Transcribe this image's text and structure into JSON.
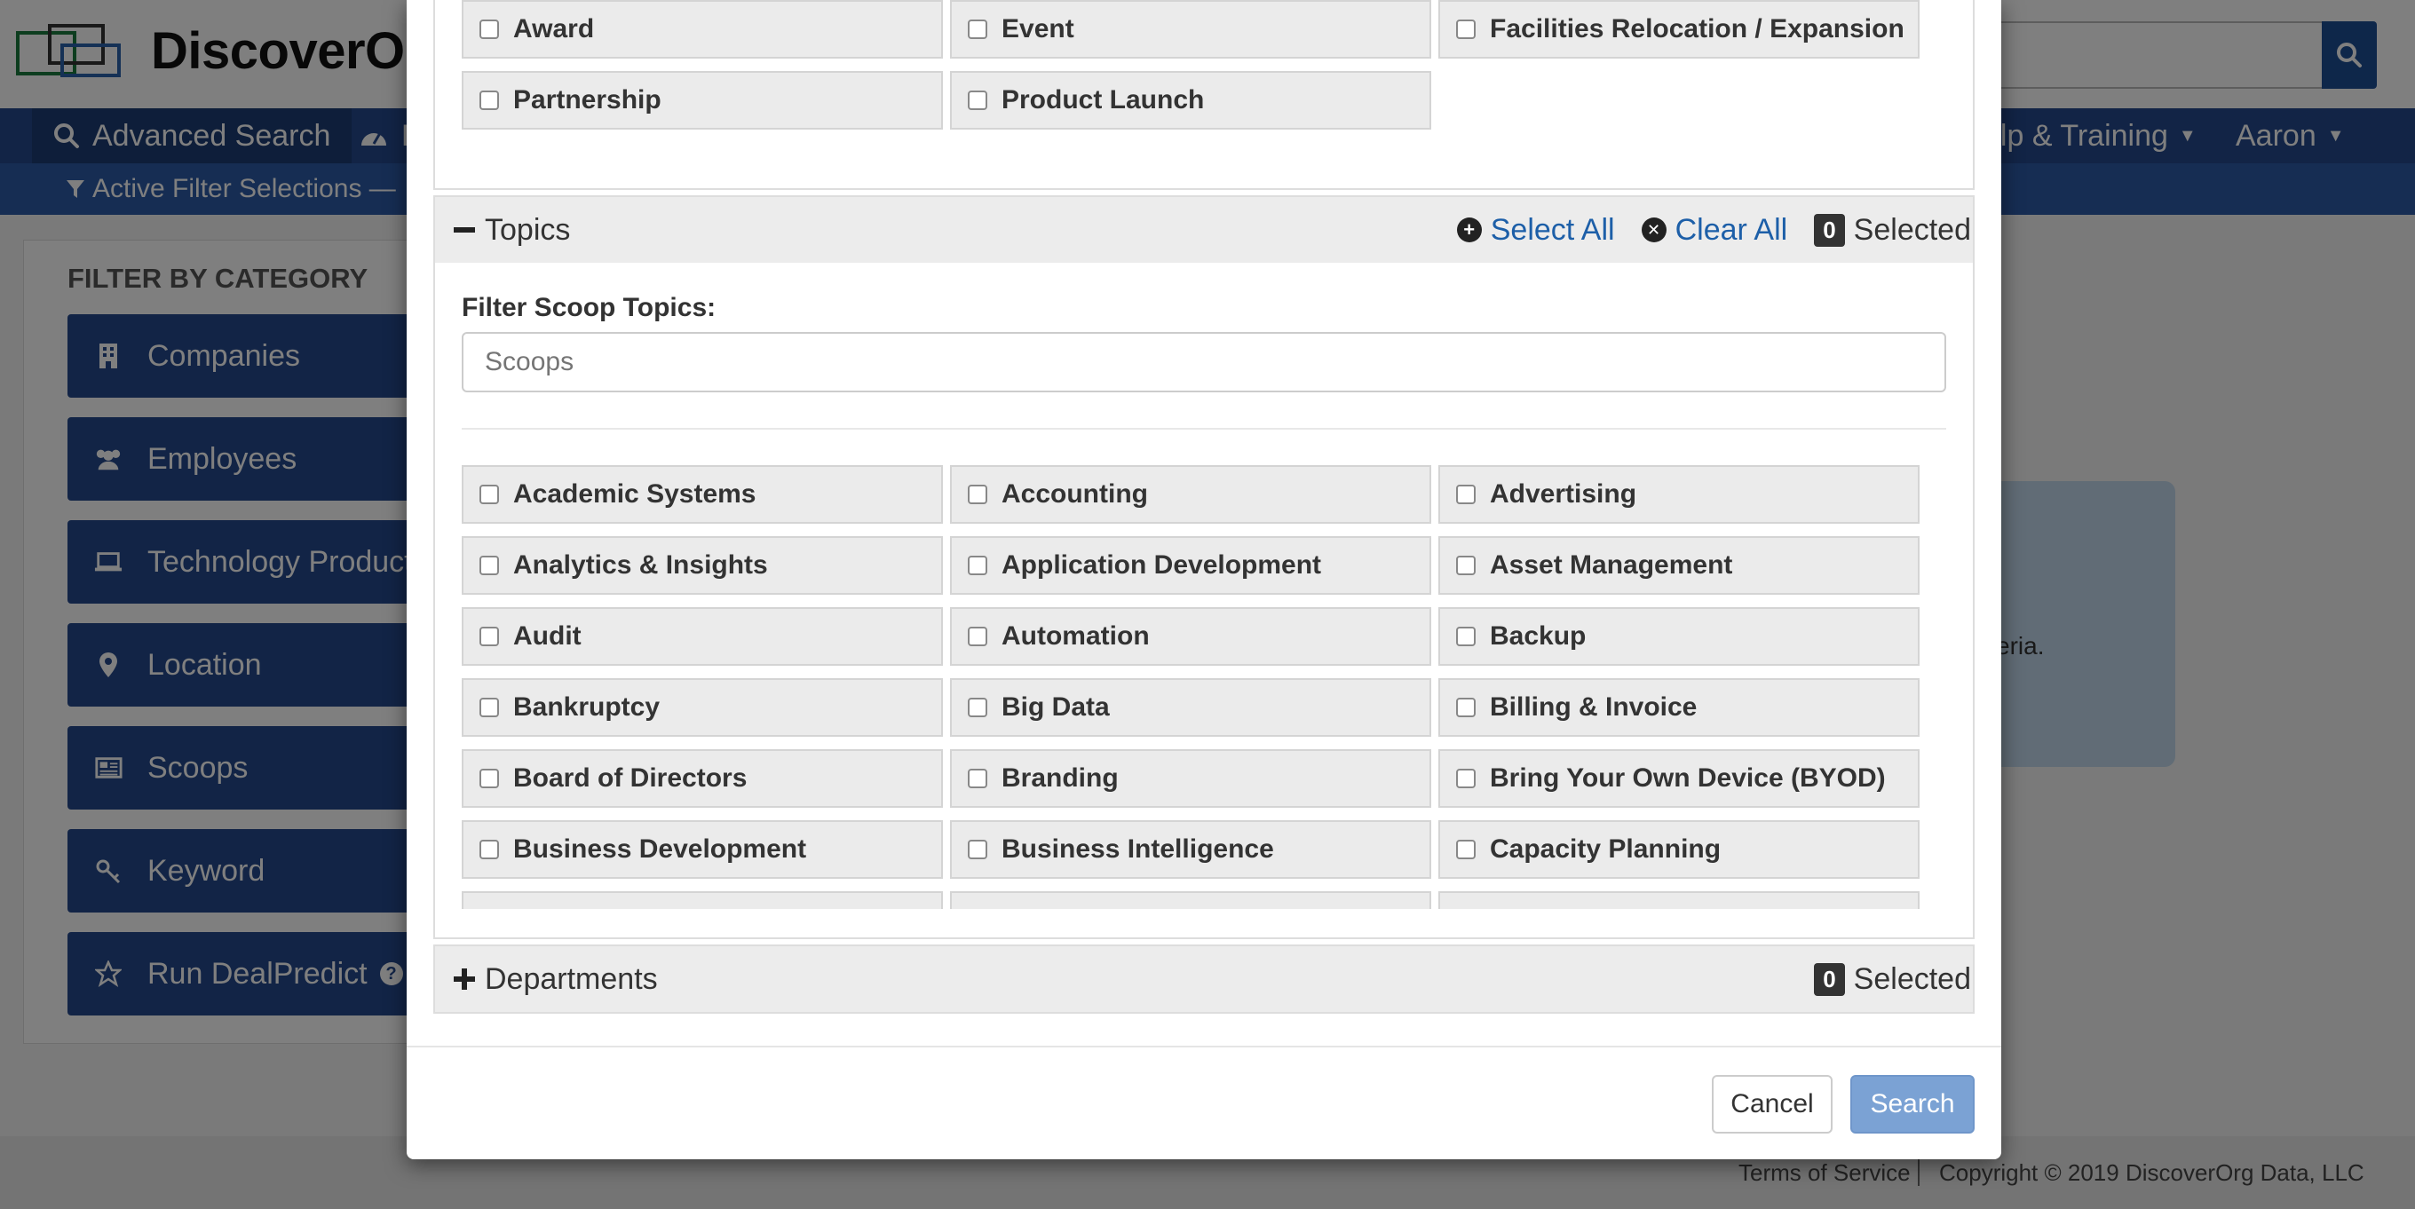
{
  "app": {
    "logo_text": "DiscoverOr",
    "nav": [
      {
        "label": "Advanced Search",
        "icon": "search-icon"
      },
      {
        "label": "D",
        "icon": "dashboard-icon"
      },
      {
        "label": "elp & Training",
        "icon": "caret-down-icon"
      },
      {
        "label": "Aaron",
        "icon": "caret-down-icon"
      }
    ],
    "active_filter_text": "Active Filter Selections — ",
    "filter_panel": {
      "title": "FILTER BY CATEGORY",
      "categories": [
        {
          "label": "Companies",
          "icon": "building-icon"
        },
        {
          "label": "Employees",
          "icon": "users-icon"
        },
        {
          "label": "Technology Products",
          "icon": "laptop-icon"
        },
        {
          "label": "Location",
          "icon": "map-pin-icon"
        },
        {
          "label": "Scoops",
          "icon": "newspaper-icon"
        },
        {
          "label": "Keyword",
          "icon": "key-icon"
        },
        {
          "label": "Run DealPredict",
          "icon": "star-icon"
        }
      ]
    },
    "info_text": "iteria.",
    "footer": {
      "terms": "Terms of Service",
      "copyright": "Copyright © 2019 DiscoverOrg Data, LLC"
    }
  },
  "modal": {
    "previous_section_items": [
      "Award",
      "Event",
      "Facilities Relocation / Expansion",
      "Partnership",
      "Product Launch"
    ],
    "topics": {
      "title": "Topics",
      "select_all": "Select All",
      "clear_all": "Clear All",
      "selected_count": "0",
      "selected_label": "Selected",
      "filter_label": "Filter Scoop Topics:",
      "filter_placeholder": "Scoops",
      "items": [
        "Academic Systems",
        "Accounting",
        "Advertising",
        "Analytics & Insights",
        "Application Development",
        "Asset Management",
        "Audit",
        "Automation",
        "Backup",
        "Bankruptcy",
        "Big Data",
        "Billing & Invoice",
        "Board of Directors",
        "Branding",
        "Bring Your Own Device (BYOD)",
        "Business Development",
        "Business Intelligence",
        "Capacity Planning"
      ]
    },
    "departments": {
      "title": "Departments",
      "selected_count": "0",
      "selected_label": "Selected"
    },
    "buttons": {
      "cancel": "Cancel",
      "search": "Search"
    }
  }
}
